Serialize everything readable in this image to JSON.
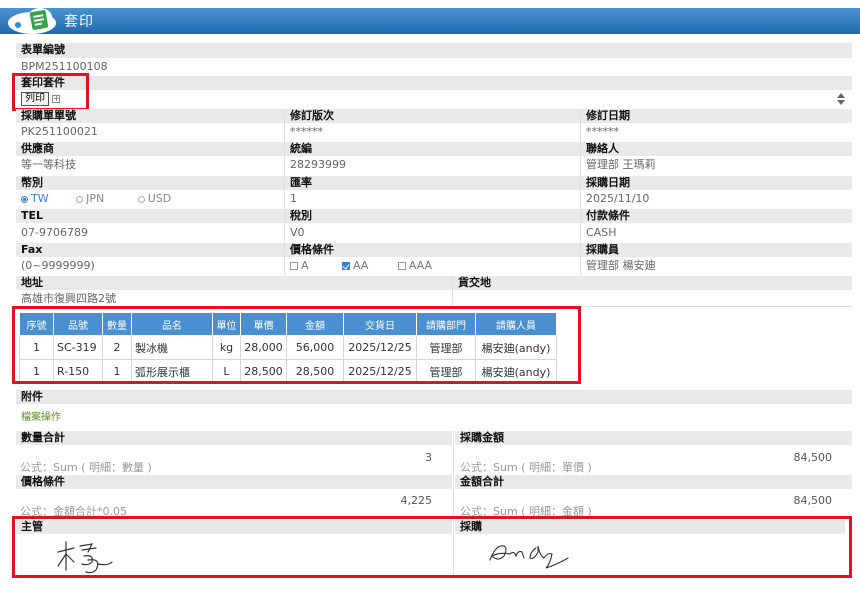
{
  "title": "套印",
  "form": {
    "form_no": {
      "label": "表單編號",
      "value": "BPM251100108"
    },
    "print_kit": {
      "label": "套印套件",
      "button": "列印",
      "expand": "+"
    },
    "purchase_no": {
      "label": "採購單單號",
      "value": "PK251100021"
    },
    "revision": {
      "label": "修訂版次",
      "value": "******"
    },
    "revision_date": {
      "label": "修訂日期",
      "value": "******"
    },
    "supplier": {
      "label": "供應商",
      "value": "等一等科技"
    },
    "tax_id": {
      "label": "統編",
      "value": "28293999"
    },
    "contact": {
      "label": "聯絡人",
      "value": "管理部 王瑪莉"
    },
    "currency": {
      "label": "幣別",
      "options": [
        "TW",
        "JPN",
        "USD"
      ],
      "selected": "TW"
    },
    "rate": {
      "label": "匯率",
      "value": "1"
    },
    "purchase_date": {
      "label": "採購日期",
      "value": "2025/11/10"
    },
    "tel": {
      "label": "TEL",
      "value": "07-9706789"
    },
    "tax_type": {
      "label": "稅別",
      "value": "V0"
    },
    "payment": {
      "label": "付款條件",
      "value": "CASH"
    },
    "fax": {
      "label": "Fax",
      "value": "(0~9999999)"
    },
    "price_terms": {
      "label": "價格條件",
      "options": [
        "A",
        "AA",
        "AAA"
      ],
      "checked": "AA"
    },
    "buyer": {
      "label": "採購員",
      "value": "管理部 楊安廸"
    },
    "address": {
      "label": "地址",
      "value": "高雄市復興四路2號"
    },
    "delivery": {
      "label": "貨交地",
      "value": ""
    }
  },
  "detail": {
    "columns": [
      "序號",
      "品號",
      "數量",
      "品名",
      "單位",
      "單價",
      "金額",
      "交貨日",
      "請購部門",
      "請購人員"
    ],
    "rows": [
      [
        "1",
        "SC-319",
        "2",
        "製冰機",
        "kg",
        "28,000",
        "56,000",
        "2025/12/25",
        "管理部",
        "楊安廸(andy)"
      ],
      [
        "1",
        "R-150",
        "1",
        "弧形展示櫃",
        "L",
        "28,500",
        "28,500",
        "2025/12/25",
        "管理部",
        "楊安廸(andy)"
      ]
    ]
  },
  "attachment": {
    "label": "附件",
    "link": "檔案操作"
  },
  "totals": {
    "qty": {
      "label": "數量合計",
      "value": "3",
      "formula": "公式：Sum ( 明細：數量 )"
    },
    "amount": {
      "label": "採購金額",
      "value": "84,500",
      "formula": "公式：Sum ( 明細：單價 )"
    },
    "price_terms": {
      "label": "價格條件",
      "value": "4,225",
      "formula": "公式：金額合計*0.05"
    },
    "amount_total": {
      "label": "金額合計",
      "value": "84,500",
      "formula": "公式：Sum ( 明細：金額 )"
    }
  },
  "signatures": {
    "manager": {
      "label": "主管"
    },
    "purchase": {
      "label": "採購"
    }
  },
  "colors": {
    "title_bar": "#1f6aaf",
    "table_header": "#4a8fcf",
    "highlight": "#e0141e",
    "link": "#5a8c1a"
  }
}
